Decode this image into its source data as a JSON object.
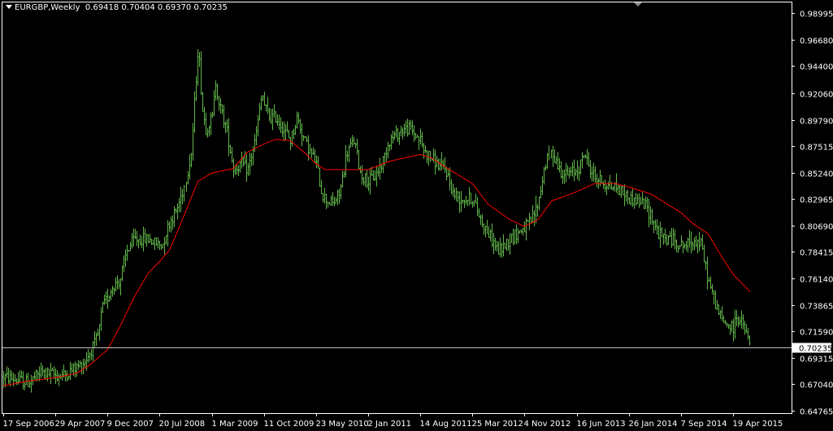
{
  "header": {
    "symbol": "EURGBP,Weekly",
    "ohlc": "0.69418 0.70404 0.69370 0.70235"
  },
  "colors": {
    "background": "#000000",
    "frame": "#ffffff",
    "bar": "#62b74a",
    "moving_average": "#ff0000",
    "price_line": "#c0c0c0",
    "price_tag_bg": "#ffffff",
    "price_tag_text": "#000000"
  },
  "chart_data": {
    "type": "bar",
    "title": "EURGBP,Weekly",
    "xlabel": "",
    "ylabel": "",
    "ylim": [
      0.6455,
      0.9988
    ],
    "x_ticks": [
      "17 Sep 2006",
      "29 Apr 2007",
      "9 Dec 2007",
      "20 Jul 2008",
      "1 Mar 2009",
      "11 Oct 2009",
      "23 May 2010",
      "2 Jan 2011",
      "14 Aug 2011",
      "25 Mar 2012",
      "4 Nov 2012",
      "16 Jun 2013",
      "26 Jan 2014",
      "7 Sep 2014",
      "19 Apr 2015"
    ],
    "y_ticks": [
      0.98995,
      0.9668,
      0.944,
      0.9206,
      0.8979,
      0.87515,
      0.8524,
      0.82965,
      0.8069,
      0.78415,
      0.7614,
      0.73865,
      0.7159,
      0.69315,
      0.6704,
      0.64765
    ],
    "current_price": 0.70235,
    "current_price_label": "0.70235",
    "price_anchors": [
      [
        "17 Sep 2006",
        0.677
      ],
      [
        "1 Dec 2006",
        0.673
      ],
      [
        "1 Jan 2007",
        0.672
      ],
      [
        "1 Mar 2007",
        0.681
      ],
      [
        "29 Apr 2007",
        0.678
      ],
      [
        "1 Jun 2007",
        0.678
      ],
      [
        "1 Aug 2007",
        0.685
      ],
      [
        "1 Sep 2007",
        0.69
      ],
      [
        "1 Oct 2007",
        0.7
      ],
      [
        "15 Oct 2007",
        0.705
      ],
      [
        "1 Nov 2007",
        0.715
      ],
      [
        "15 Nov 2007",
        0.735
      ],
      [
        "9 Dec 2007",
        0.745
      ],
      [
        "1 Jan 2008",
        0.755
      ],
      [
        "1 Feb 2008",
        0.76
      ],
      [
        "1 Mar 2008",
        0.785
      ],
      [
        "1 Apr 2008",
        0.795
      ],
      [
        "1 May 2008",
        0.795
      ],
      [
        "1 Jun 2008",
        0.795
      ],
      [
        "20 Jul 2008",
        0.79
      ],
      [
        "1 Aug 2008",
        0.79
      ],
      [
        "15 Aug 2008",
        0.8
      ],
      [
        "1 Sep 2008",
        0.81
      ],
      [
        "1 Oct 2008",
        0.82
      ],
      [
        "1 Nov 2008",
        0.84
      ],
      [
        "1 Dec 2008",
        0.87
      ],
      [
        "29 Dec 2008",
        0.96
      ],
      [
        "7 Jan 2009",
        0.94
      ],
      [
        "15 Jan 2009",
        0.91
      ],
      [
        "1 Feb 2009",
        0.89
      ],
      [
        "1 Mar 2009",
        0.9
      ],
      [
        "15 Mar 2009",
        0.93
      ],
      [
        "1 Apr 2009",
        0.91
      ],
      [
        "1 May 2009",
        0.89
      ],
      [
        "1 Jun 2009",
        0.855
      ],
      [
        "1 Jul 2009",
        0.86
      ],
      [
        "1 Aug 2009",
        0.855
      ],
      [
        "1 Sep 2009",
        0.88
      ],
      [
        "1 Oct 2009",
        0.92
      ],
      [
        "11 Oct 2009",
        0.91
      ],
      [
        "1 Nov 2009",
        0.9
      ],
      [
        "1 Dec 2009",
        0.9
      ],
      [
        "1 Jan 2010",
        0.89
      ],
      [
        "1 Feb 2010",
        0.88
      ],
      [
        "1 Mar 2010",
        0.9
      ],
      [
        "1 Apr 2010",
        0.88
      ],
      [
        "23 May 2010",
        0.86
      ],
      [
        "15 Jun 2010",
        0.835
      ],
      [
        "1 Jul 2010",
        0.83
      ],
      [
        "1 Aug 2010",
        0.825
      ],
      [
        "1 Sep 2010",
        0.835
      ],
      [
        "1 Oct 2010",
        0.87
      ],
      [
        "1 Nov 2010",
        0.88
      ],
      [
        "1 Dec 2010",
        0.85
      ],
      [
        "2 Jan 2011",
        0.845
      ],
      [
        "1 Feb 2011",
        0.85
      ],
      [
        "1 Mar 2011",
        0.86
      ],
      [
        "1 Apr 2011",
        0.88
      ],
      [
        "1 May 2011",
        0.885
      ],
      [
        "1 Jun 2011",
        0.89
      ],
      [
        "1 Jul 2011",
        0.89
      ],
      [
        "14 Aug 2011",
        0.88
      ],
      [
        "1 Sep 2011",
        0.87
      ],
      [
        "1 Oct 2011",
        0.865
      ],
      [
        "1 Nov 2011",
        0.858
      ],
      [
        "1 Dec 2011",
        0.855
      ],
      [
        "1 Jan 2012",
        0.835
      ],
      [
        "1 Feb 2012",
        0.83
      ],
      [
        "25 Mar 2012",
        0.83
      ],
      [
        "1 May 2012",
        0.812
      ],
      [
        "1 Jun 2012",
        0.8
      ],
      [
        "15 Jul 2012",
        0.785
      ],
      [
        "1 Aug 2012",
        0.788
      ],
      [
        "1 Sep 2012",
        0.795
      ],
      [
        "1 Oct 2012",
        0.8
      ],
      [
        "4 Nov 2012",
        0.805
      ],
      [
        "1 Dec 2012",
        0.81
      ],
      [
        "1 Jan 2013",
        0.825
      ],
      [
        "1 Feb 2013",
        0.86
      ],
      [
        "1 Mar 2013",
        0.87
      ],
      [
        "1 Apr 2013",
        0.855
      ],
      [
        "1 May 2013",
        0.85
      ],
      [
        "16 Jun 2013",
        0.855
      ],
      [
        "1 Jul 2013",
        0.86
      ],
      [
        "15 Jul 2013",
        0.87
      ],
      [
        "1 Aug 2013",
        0.86
      ],
      [
        "1 Sep 2013",
        0.848
      ],
      [
        "1 Oct 2013",
        0.845
      ],
      [
        "1 Nov 2013",
        0.84
      ],
      [
        "1 Dec 2013",
        0.84
      ],
      [
        "26 Jan 2014",
        0.83
      ],
      [
        "1 Mar 2014",
        0.828
      ],
      [
        "1 Apr 2014",
        0.825
      ],
      [
        "1 May 2014",
        0.815
      ],
      [
        "1 Jun 2014",
        0.8
      ],
      [
        "1 Jul 2014",
        0.795
      ],
      [
        "1 Aug 2014",
        0.795
      ],
      [
        "7 Sep 2014",
        0.79
      ],
      [
        "1 Oct 2014",
        0.79
      ],
      [
        "1 Nov 2014",
        0.795
      ],
      [
        "1 Dec 2014",
        0.79
      ],
      [
        "1 Jan 2015",
        0.76
      ],
      [
        "1 Feb 2015",
        0.74
      ],
      [
        "1 Mar 2015",
        0.725
      ],
      [
        "19 Apr 2015",
        0.718
      ],
      [
        "1 May 2015",
        0.73
      ],
      [
        "1 Jun 2015",
        0.72
      ],
      [
        "1 Jul 2015",
        0.703
      ]
    ],
    "moving_average": [
      [
        "17 Sep 2006",
        0.669
      ],
      [
        "1 Jan 2007",
        0.673
      ],
      [
        "29 Apr 2007",
        0.676
      ],
      [
        "1 Aug 2007",
        0.68
      ],
      [
        "1 Oct 2007",
        0.688
      ],
      [
        "9 Dec 2007",
        0.7
      ],
      [
        "1 Feb 2008",
        0.72
      ],
      [
        "1 Apr 2008",
        0.745
      ],
      [
        "1 Jun 2008",
        0.766
      ],
      [
        "20 Jul 2008",
        0.776
      ],
      [
        "1 Sep 2008",
        0.786
      ],
      [
        "1 Oct 2008",
        0.8
      ],
      [
        "1 Nov 2008",
        0.815
      ],
      [
        "1 Dec 2008",
        0.83
      ],
      [
        "1 Jan 2009",
        0.845
      ],
      [
        "1 Mar 2009",
        0.852
      ],
      [
        "1 Jun 2009",
        0.856
      ],
      [
        "1 Aug 2009",
        0.87
      ],
      [
        "11 Oct 2009",
        0.877
      ],
      [
        "1 Dec 2009",
        0.881
      ],
      [
        "1 Feb 2010",
        0.88
      ],
      [
        "1 Apr 2010",
        0.87
      ],
      [
        "23 May 2010",
        0.86
      ],
      [
        "1 Jul 2010",
        0.855
      ],
      [
        "1 Sep 2010",
        0.855
      ],
      [
        "2 Jan 2011",
        0.855
      ],
      [
        "1 Apr 2011",
        0.862
      ],
      [
        "14 Aug 2011",
        0.868
      ],
      [
        "1 Oct 2011",
        0.865
      ],
      [
        "1 Dec 2011",
        0.857
      ],
      [
        "25 Mar 2012",
        0.843
      ],
      [
        "1 Jun 2012",
        0.825
      ],
      [
        "1 Sep 2012",
        0.812
      ],
      [
        "4 Nov 2012",
        0.806
      ],
      [
        "1 Jan 2013",
        0.812
      ],
      [
        "1 Mar 2013",
        0.828
      ],
      [
        "16 Jun 2013",
        0.836
      ],
      [
        "1 Sep 2013",
        0.843
      ],
      [
        "1 Dec 2013",
        0.843
      ],
      [
        "26 Jan 2014",
        0.84
      ],
      [
        "1 May 2014",
        0.834
      ],
      [
        "7 Sep 2014",
        0.818
      ],
      [
        "1 Nov 2014",
        0.808
      ],
      [
        "1 Jan 2015",
        0.8
      ],
      [
        "1 Mar 2015",
        0.78
      ],
      [
        "19 Apr 2015",
        0.765
      ],
      [
        "1 Jul 2015",
        0.75
      ]
    ]
  }
}
